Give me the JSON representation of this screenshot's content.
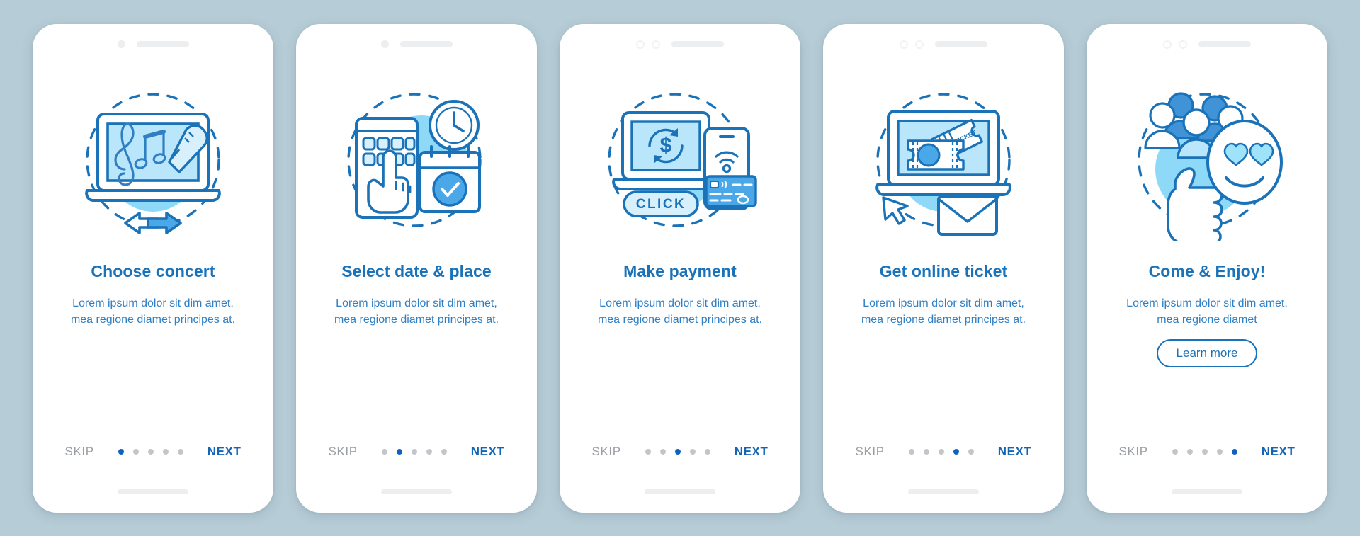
{
  "page": {
    "background_color": "#b6ccd6",
    "card_background": "#ffffff",
    "title_color": "#1a72b8",
    "body_color": "#2f7fc4",
    "accent_color": "#0f62c4",
    "muted_color": "#9a9ea3"
  },
  "common": {
    "skip_label": "SKIP",
    "next_label": "NEXT",
    "body_text": "Lorem ipsum dolor sit dim amet, mea regione diamet principes at.",
    "body_text_short": "Lorem ipsum dolor sit dim amet, mea regione diamet",
    "total_steps": 5
  },
  "screens": [
    {
      "id": "choose-concert",
      "title": "Choose concert",
      "description": "Lorem ipsum dolor sit dim amet, mea regione diamet principes at.",
      "active_dot": 1,
      "skip_label": "SKIP",
      "next_label": "NEXT",
      "illustration": "laptop-music-notes-microphone-arrows",
      "header_dots": 1,
      "cta": null
    },
    {
      "id": "select-date-place",
      "title": "Select date & place",
      "description": "Lorem ipsum dolor sit dim amet, mea regione diamet principes at.",
      "active_dot": 2,
      "skip_label": "SKIP",
      "next_label": "NEXT",
      "illustration": "phone-grid-hand-clock-calendar-check",
      "header_dots": 1,
      "cta": null
    },
    {
      "id": "make-payment",
      "title": "Make payment",
      "description": "Lorem ipsum dolor sit dim amet, mea regione diamet principes at.",
      "active_dot": 3,
      "skip_label": "SKIP",
      "next_label": "NEXT",
      "illustration": "laptop-dollar-refresh-phone-nfc-card-click",
      "header_dots": 2,
      "click_label": "CLICK",
      "cta": null
    },
    {
      "id": "get-online-ticket",
      "title": "Get online ticket",
      "description": "Lorem ipsum dolor sit dim amet, mea regione diamet principes at.",
      "active_dot": 4,
      "skip_label": "SKIP",
      "next_label": "NEXT",
      "illustration": "laptop-tickets-cursor-envelope",
      "ticket_label": "TICKET",
      "header_dots": 2,
      "cta": null
    },
    {
      "id": "come-and-enjoy",
      "title": "Come & Enjoy!",
      "description": "Lorem ipsum dolor sit dim amet, mea regione diamet",
      "active_dot": 5,
      "skip_label": "SKIP",
      "next_label": "NEXT",
      "illustration": "people-group-thumbs-up-heart-eyes-smiley",
      "header_dots": 2,
      "cta": {
        "label": "Learn more"
      }
    }
  ]
}
